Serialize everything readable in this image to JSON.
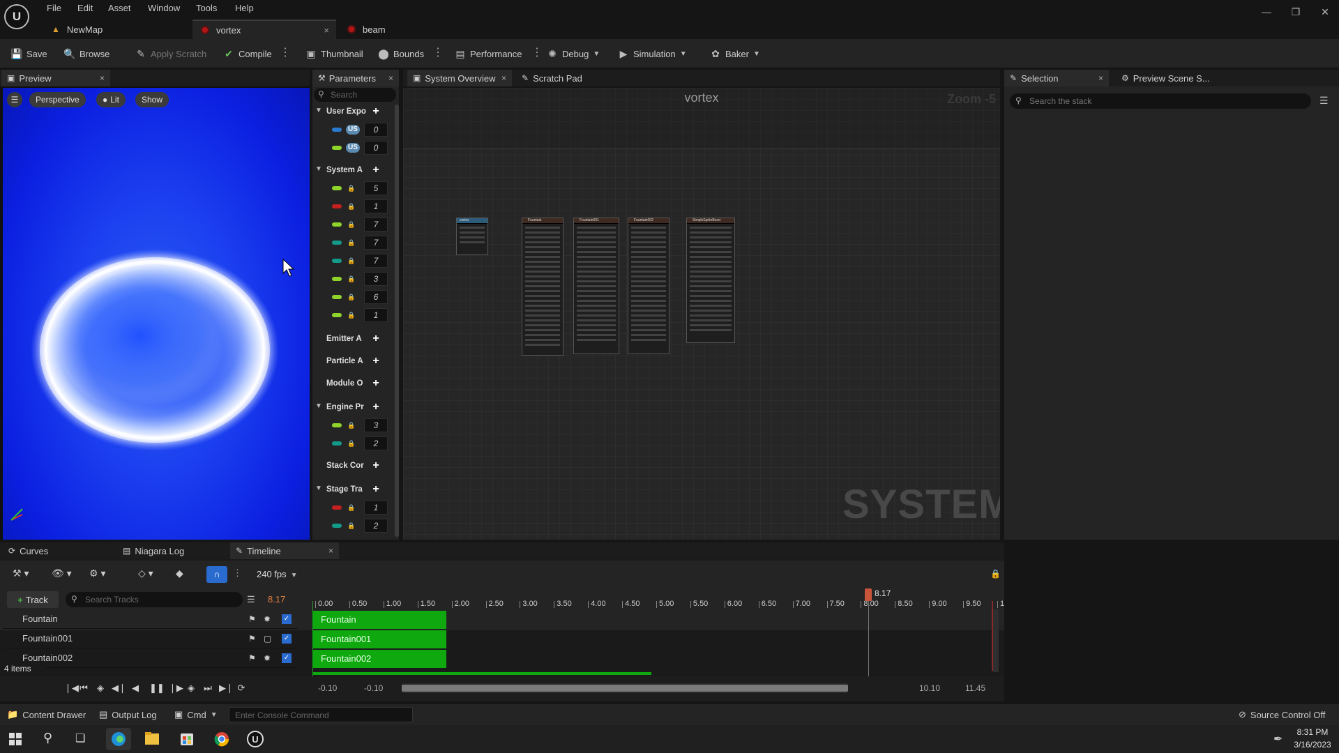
{
  "menu": [
    "File",
    "Edit",
    "Asset",
    "Window",
    "Tools",
    "Help"
  ],
  "doc_tabs": [
    {
      "label": "NewMap"
    },
    {
      "label": "vortex",
      "close": "×"
    },
    {
      "label": "beam"
    }
  ],
  "toolbar": {
    "save": "Save",
    "browse": "Browse",
    "apply_scratch": "Apply Scratch",
    "compile": "Compile",
    "thumbnail": "Thumbnail",
    "bounds": "Bounds",
    "performance": "Performance",
    "debug": "Debug",
    "simulation": "Simulation",
    "baker": "Baker"
  },
  "preview": {
    "tab": "Preview",
    "close": "×",
    "perspective": "Perspective",
    "lit": "Lit",
    "show": "Show"
  },
  "params": {
    "tab": "Parameters",
    "close": "×",
    "search_placeholder": "Search",
    "user_exposed": "User Expo",
    "user_values": [
      "0",
      "0"
    ],
    "user_badge": "US",
    "system": "System A",
    "system_values": [
      "5",
      "1",
      "7",
      "7",
      "7",
      "3",
      "6",
      "1"
    ],
    "emitter": "Emitter A",
    "particle": "Particle A",
    "module": "Module O",
    "engine": "Engine Pr",
    "engine_values": [
      "3",
      "2"
    ],
    "stack": "Stack Cor",
    "stage": "Stage Tra",
    "stage_values": [
      "1",
      "2"
    ]
  },
  "graph": {
    "tab_overview": "System Overview",
    "close": "×",
    "tab_scratch": "Scratch Pad",
    "title": "vortex",
    "zoom": "Zoom -5",
    "watermark": "SYSTEM",
    "nodes": [
      "vortex",
      "Fountain",
      "Fountain001",
      "Fountain002",
      "SimpleSpriteBurst"
    ]
  },
  "selection": {
    "tab": "Selection",
    "close": "×",
    "tab_preview": "Preview Scene S...",
    "search_placeholder": "Search the stack"
  },
  "bottom": {
    "tab_curves": "Curves",
    "tab_log": "Niagara Log",
    "tab_timeline": "Timeline",
    "close": "×",
    "fps": "240 fps",
    "add_track": "Track",
    "search_tracks_placeholder": "Search Tracks",
    "current_time": "8.17",
    "playhead_label": "8.17",
    "items_count": "4 items",
    "tracks": [
      "Fountain",
      "Fountain001",
      "Fountain002"
    ],
    "ticks": [
      "0.00",
      "0.50",
      "1.00",
      "1.50",
      "2.00",
      "2.50",
      "3.00",
      "3.50",
      "4.00",
      "4.50",
      "5.00",
      "5.50",
      "6.00",
      "6.50",
      "7.00",
      "7.50",
      "8.00",
      "8.50",
      "9.00",
      "9.50",
      "1"
    ],
    "range_start": "-0.10",
    "view_start": "-0.10",
    "view_end": "10.10",
    "range_end": "11.45"
  },
  "status": {
    "content_drawer": "Content Drawer",
    "output_log": "Output Log",
    "cmd": "Cmd",
    "console_placeholder": "Enter Console Command",
    "source_control": "Source Control Off"
  },
  "taskbar": {
    "time": "8:31 PM",
    "date": "3/16/2023"
  }
}
